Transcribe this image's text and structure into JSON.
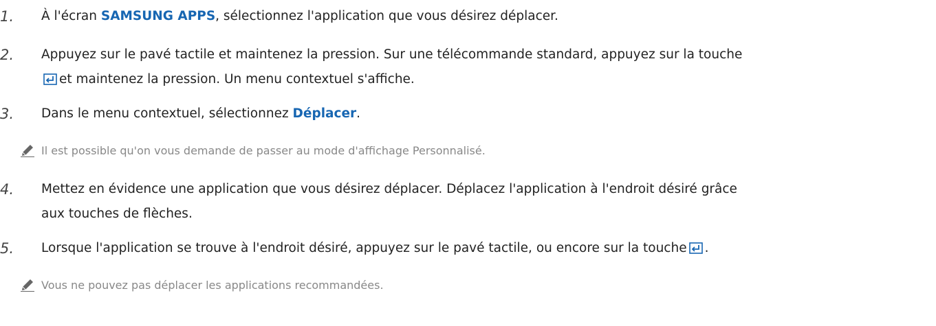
{
  "steps": [
    {
      "num": "1.",
      "before": "À l'écran ",
      "highlight": "SAMSUNG APPS",
      "after": ", sélectionnez l'application que vous désirez déplacer."
    },
    {
      "num": "2.",
      "line1": "Appuyez sur le pavé tactile et maintenez la pression. Sur une télécommande standard, appuyez sur la touche",
      "line2": "et maintenez la pression. Un menu contextuel s'affiche."
    },
    {
      "num": "3.",
      "before": "Dans le menu contextuel, sélectionnez ",
      "highlight": "Déplacer",
      "after": "."
    },
    {
      "num": "4.",
      "line1": "Mettez en évidence une application que vous désirez déplacer. Déplacez l'application à l'endroit désiré grâce",
      "line2": "aux touches de flèches."
    },
    {
      "num": "5.",
      "before": "Lorsque l'application se trouve à l'endroit désiré, appuyez sur le pavé tactile, ou encore sur la touche",
      "after": "."
    }
  ],
  "notes": [
    {
      "icon": "pencil-icon",
      "text": "Il est possible qu'on vous demande de passer au mode d'affichage Personnalisé."
    },
    {
      "icon": "pencil-icon",
      "text": "Vous ne pouvez pas déplacer les applications recommandées."
    }
  ],
  "colors": {
    "highlight": "#1766b2",
    "note_text": "#888888",
    "key_icon": "#1766b2"
  }
}
